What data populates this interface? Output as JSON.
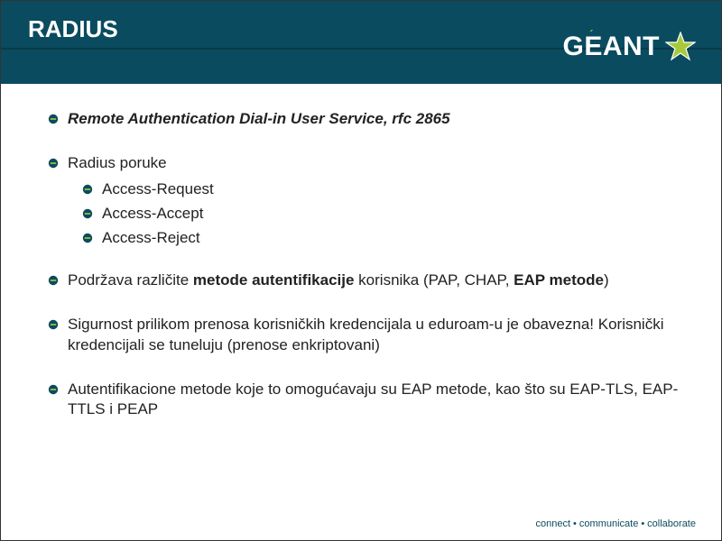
{
  "header": {
    "title": "RADIUS",
    "logo_text_1": "G",
    "logo_text_2": "E",
    "logo_text_3": "ANT",
    "logo_accent": "´"
  },
  "content": {
    "items": [
      {
        "html": "<span class='bi'>Remote Authentication Dial-in User Service, rfc 2865</span>"
      },
      {
        "text": "Radius poruke",
        "children": [
          {
            "text": "Access-Request"
          },
          {
            "text": "Access-Accept"
          },
          {
            "text": "Access-Reject"
          }
        ]
      },
      {
        "html": "Podržava različite <b>metode autentifikacije</b> korisnika (PAP, CHAP, <b>EAP metode</b>)"
      },
      {
        "text": "Sigurnost prilikom prenosa korisničkih kredencijala u eduroam-u je obavezna! Korisnički kredencijali se tuneluju (prenose enkriptovani)"
      },
      {
        "text": "Autentifikacione metode koje to omogućavaju su EAP metode, kao što su EAP-TLS, EAP-TTLS i PEAP"
      }
    ]
  },
  "footer": {
    "w1": "connect",
    "w2": "communicate",
    "w3": "collaborate"
  },
  "colors": {
    "teal": "#0a4b5f",
    "green": "#a7c93a"
  }
}
